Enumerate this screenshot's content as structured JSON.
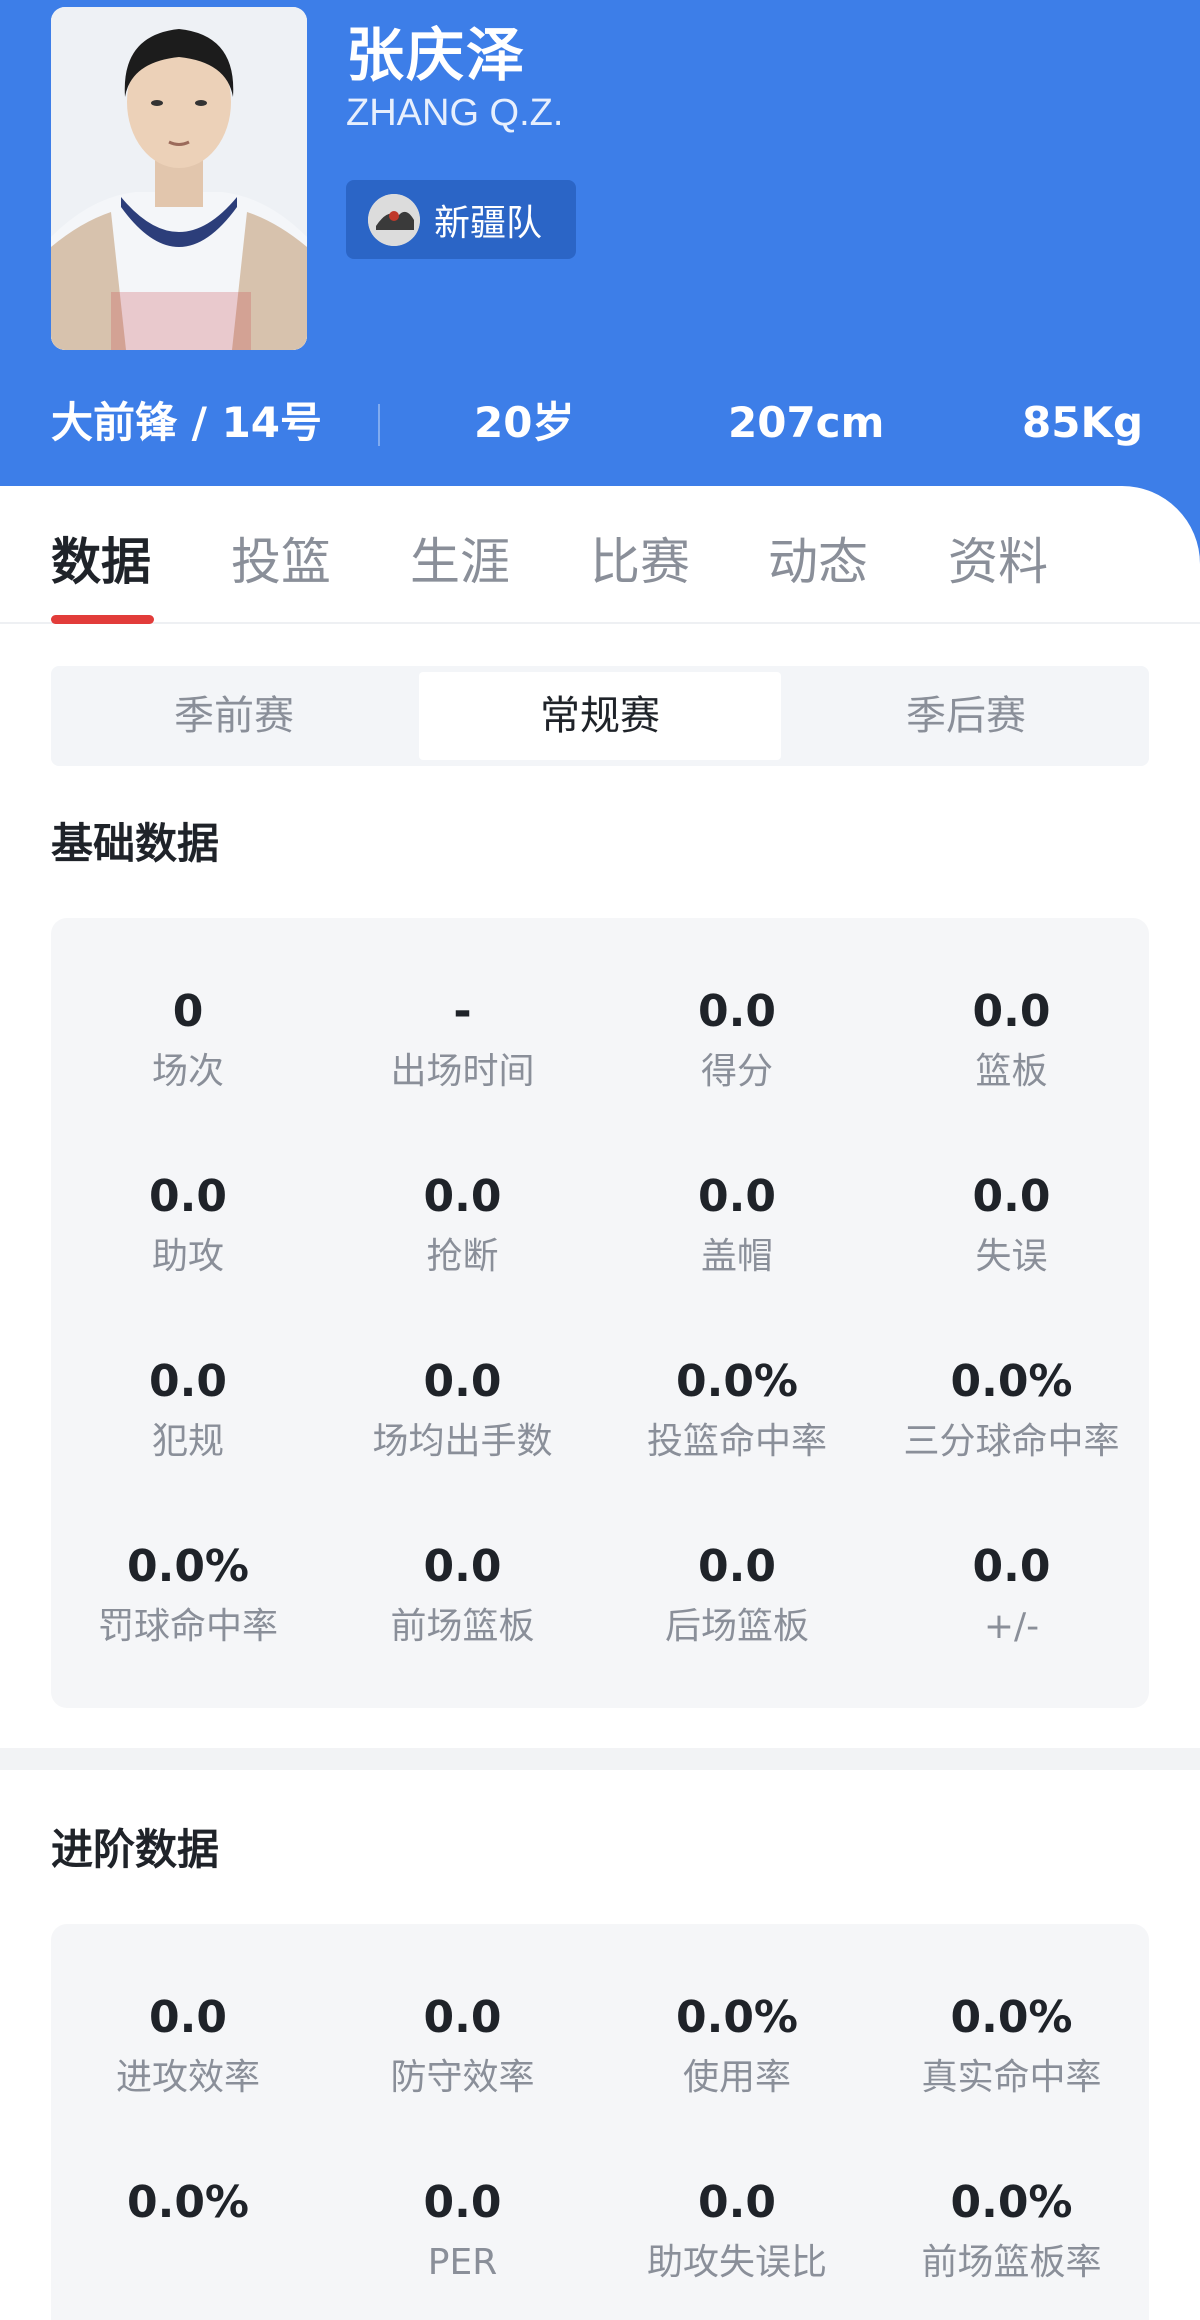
{
  "player": {
    "name_cn": "张庆泽",
    "name_en": "ZHANG Q.Z.",
    "team": "新疆队",
    "position_number": "大前锋 / 14号",
    "age": "20岁",
    "height": "207cm",
    "weight": "85Kg"
  },
  "tabs": [
    "数据",
    "投篮",
    "生涯",
    "比赛",
    "动态",
    "资料"
  ],
  "active_tab": "数据",
  "season_tabs": [
    "季前赛",
    "常规赛",
    "季后赛"
  ],
  "active_season": "常规赛",
  "basic": {
    "title": "基础数据",
    "stats": [
      {
        "value": "0",
        "label": "场次"
      },
      {
        "value": "-",
        "label": "出场时间"
      },
      {
        "value": "0.0",
        "label": "得分"
      },
      {
        "value": "0.0",
        "label": "篮板"
      },
      {
        "value": "0.0",
        "label": "助攻"
      },
      {
        "value": "0.0",
        "label": "抢断"
      },
      {
        "value": "0.0",
        "label": "盖帽"
      },
      {
        "value": "0.0",
        "label": "失误"
      },
      {
        "value": "0.0",
        "label": "犯规"
      },
      {
        "value": "0.0",
        "label": "场均出手数"
      },
      {
        "value": "0.0%",
        "label": "投篮命中率"
      },
      {
        "value": "0.0%",
        "label": "三分球命中率"
      },
      {
        "value": "0.0%",
        "label": "罚球命中率"
      },
      {
        "value": "0.0",
        "label": "前场篮板"
      },
      {
        "value": "0.0",
        "label": "后场篮板"
      },
      {
        "value": "0.0",
        "label": "+/-"
      }
    ]
  },
  "advanced": {
    "title": "进阶数据",
    "stats": [
      {
        "value": "0.0",
        "label": "进攻效率"
      },
      {
        "value": "0.0",
        "label": "防守效率"
      },
      {
        "value": "0.0%",
        "label": "使用率"
      },
      {
        "value": "0.0%",
        "label": "真实命中率"
      },
      {
        "value": "0.0%",
        "label": ""
      },
      {
        "value": "0.0",
        "label": "PER"
      },
      {
        "value": "0.0",
        "label": "助攻失误比"
      },
      {
        "value": "0.0%",
        "label": "前场篮板率"
      }
    ]
  },
  "colors": {
    "header_blue": "#3d7ee8",
    "accent_red": "#e23c3a",
    "card_bg": "#f5f6f8"
  }
}
